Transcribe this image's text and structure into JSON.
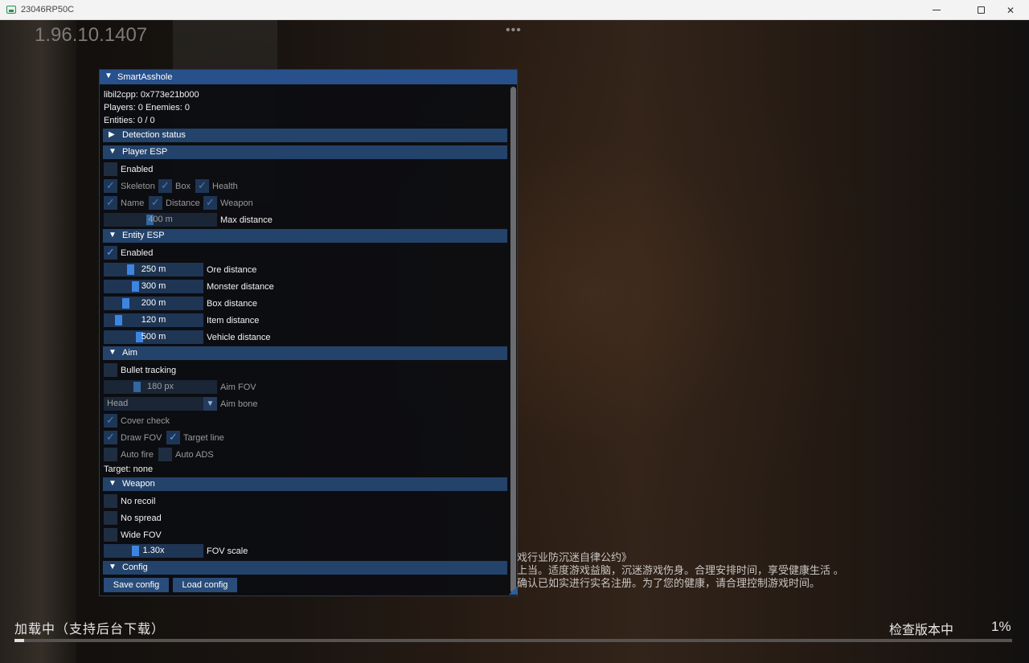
{
  "window": {
    "title": "23046RP50C"
  },
  "game": {
    "version": "1.96.10.1407",
    "dots": "•••",
    "notice_lines": [
      "戏行业防沉迷自律公约》",
      "上当。适度游戏益脑，沉迷游戏伤身。合理安排时间，享受健康生活 。",
      "确认已如实进行实名注册。为了您的健康，请合理控制游戏时间。"
    ],
    "loading_text": "加载中（支持后台下载）",
    "check_text": "检查版本中",
    "percent_text": "1%",
    "progress": 0.01
  },
  "menu": {
    "title": "SmartAsshole",
    "info": {
      "lib": "libil2cpp: 0x773e21b000",
      "players": "Players: 0  Enemies: 0",
      "entities": "Entities: 0 / 0"
    },
    "detection": {
      "header": "Detection status"
    },
    "player_esp": {
      "header": "Player ESP",
      "enabled": "Enabled",
      "skeleton": "Skeleton",
      "box": "Box",
      "health": "Health",
      "name": "Name",
      "distance": "Distance",
      "weapon": "Weapon",
      "max_distance_value": "400 m",
      "max_distance_label": "Max distance",
      "max_distance_level": 0.4
    },
    "entity_esp": {
      "header": "Entity ESP",
      "enabled": "Enabled",
      "sliders": [
        {
          "value": "250 m",
          "label": "Ore distance",
          "level": 0.25
        },
        {
          "value": "300 m",
          "label": "Monster distance",
          "level": 0.3
        },
        {
          "value": "200 m",
          "label": "Box distance",
          "level": 0.2
        },
        {
          "value": "120 m",
          "label": "Item distance",
          "level": 0.12
        },
        {
          "value": "500 m",
          "label": "Vehicle distance",
          "level": 0.35
        }
      ]
    },
    "aim": {
      "header": "Aim",
      "bullet_tracking": "Bullet tracking",
      "fov_value": "180 px",
      "fov_label": "Aim FOV",
      "fov_level": 0.28,
      "bone_value": "Head",
      "bone_label": "Aim bone",
      "cover_check": "Cover check",
      "draw_fov": "Draw FOV",
      "target_line": "Target line",
      "auto_fire": "Auto fire",
      "auto_ads": "Auto ADS",
      "target": "Target: none"
    },
    "weapon": {
      "header": "Weapon",
      "no_recoil": "No recoil",
      "no_spread": "No spread",
      "wide_fov": "Wide FOV",
      "fov_scale_value": "1.30x",
      "fov_scale_label": "FOV scale",
      "fov_scale_level": 0.3
    },
    "config": {
      "header": "Config",
      "save": "Save config",
      "load": "Load config"
    }
  }
}
